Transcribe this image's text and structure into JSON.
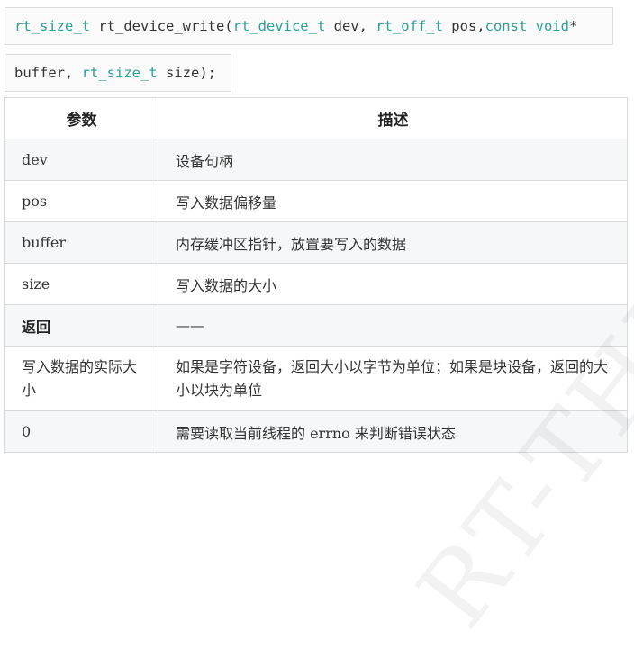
{
  "code": {
    "line1": [
      {
        "text": "rt_size_t",
        "kw": true
      },
      {
        "text": " rt_device_write(",
        "kw": false
      },
      {
        "text": "rt_device_t",
        "kw": true
      },
      {
        "text": " dev, ",
        "kw": false
      },
      {
        "text": "rt_off_t",
        "kw": true
      },
      {
        "text": " pos,",
        "kw": false
      },
      {
        "text": "const void",
        "kw": true
      },
      {
        "text": "*",
        "kw": false
      }
    ],
    "line2": [
      {
        "text": "buffer, ",
        "kw": false
      },
      {
        "text": "rt_size_t",
        "kw": true
      },
      {
        "text": " size);",
        "kw": false
      }
    ]
  },
  "table": {
    "headers": [
      "参数",
      "描述"
    ],
    "rows": [
      {
        "param": "dev",
        "desc": "设备句柄",
        "bold": false
      },
      {
        "param": "pos",
        "desc": "写入数据偏移量",
        "bold": false
      },
      {
        "param": "buffer",
        "desc": "内存缓冲区指针，放置要写入的数据",
        "bold": false
      },
      {
        "param": "size",
        "desc": "写入数据的大小",
        "bold": false
      },
      {
        "param": "返回",
        "desc": "——",
        "bold": true
      },
      {
        "param": "写入数据的实际大小",
        "desc": "如果是字符设备，返回大小以字节为单位；如果是块设备，返回的大小以块为单位",
        "bold": false
      },
      {
        "param": "0",
        "desc": "需要读取当前线程的 errno 来判断错误状态",
        "bold": false
      }
    ]
  },
  "watermark": "RT-THREAD"
}
